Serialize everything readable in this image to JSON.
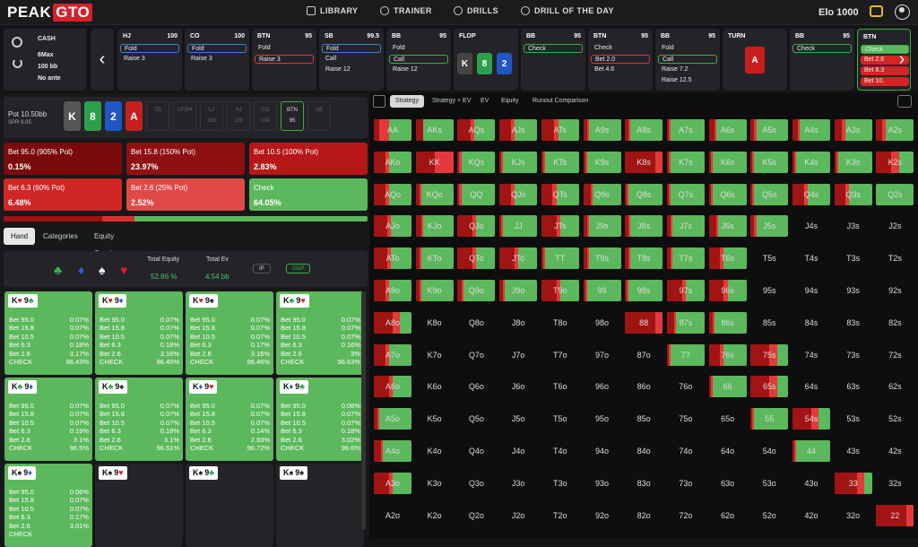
{
  "header": {
    "logo_a": "PEAK",
    "logo_b": "GTO",
    "nav": [
      "LIBRARY",
      "TRAINER",
      "DRILLS",
      "DRILL OF THE DAY"
    ],
    "elo": "Elo 1000"
  },
  "info": {
    "game": "CASH",
    "players": "6Max",
    "stack": "100 bb",
    "ante": "No ante"
  },
  "actions": [
    {
      "pos": "HJ",
      "stack": "100",
      "opts": [
        {
          "t": "Fold",
          "s": "blue"
        },
        {
          "t": "Raise 3",
          "s": ""
        }
      ]
    },
    {
      "pos": "CO",
      "stack": "100",
      "opts": [
        {
          "t": "Fold",
          "s": "blue"
        },
        {
          "t": "Raise 3",
          "s": ""
        }
      ]
    },
    {
      "pos": "BTN",
      "stack": "95",
      "opts": [
        {
          "t": "Fold",
          "s": ""
        },
        {
          "t": "Raise 3",
          "s": "red"
        }
      ]
    },
    {
      "pos": "SB",
      "stack": "99.5",
      "opts": [
        {
          "t": "Fold",
          "s": "blue"
        },
        {
          "t": "Call",
          "s": ""
        },
        {
          "t": "Raise 12",
          "s": ""
        }
      ]
    },
    {
      "pos": "BB",
      "stack": "95",
      "opts": [
        {
          "t": "Fold",
          "s": ""
        },
        {
          "t": "Call",
          "s": "green"
        },
        {
          "t": "Raise 12",
          "s": ""
        }
      ]
    },
    {
      "pos": "FLOP",
      "stack": "",
      "opts": []
    },
    {
      "pos": "BB",
      "stack": "95",
      "opts": [
        {
          "t": "Check",
          "s": "green"
        }
      ]
    },
    {
      "pos": "BTN",
      "stack": "95",
      "opts": [
        {
          "t": "Check",
          "s": ""
        },
        {
          "t": "Bet 2.0",
          "s": "red"
        },
        {
          "t": "Bet 4.6",
          "s": ""
        }
      ]
    },
    {
      "pos": "BB",
      "stack": "95",
      "opts": [
        {
          "t": "Fold",
          "s": ""
        },
        {
          "t": "Call",
          "s": "green"
        },
        {
          "t": "Raise 7.2",
          "s": ""
        },
        {
          "t": "Raise 12.5",
          "s": ""
        }
      ]
    },
    {
      "pos": "TURN",
      "stack": "",
      "opts": []
    },
    {
      "pos": "BB",
      "stack": "95",
      "opts": [
        {
          "t": "Check",
          "s": "green"
        }
      ]
    },
    {
      "pos": "BTN",
      "stack": "",
      "opts": [
        {
          "t": "Check",
          "s": "green"
        },
        {
          "t": "Bet 2.6",
          "s": ""
        },
        {
          "t": "Bet 6.3",
          "s": ""
        },
        {
          "t": "Bet 10.",
          "s": ""
        }
      ]
    }
  ],
  "flop_cards": [
    {
      "r": "K",
      "c": "#444"
    },
    {
      "r": "8",
      "c": "#2aa04a"
    },
    {
      "r": "2",
      "c": "#1f56c4"
    }
  ],
  "turn_card": {
    "r": "A",
    "c": "#c81e1e"
  },
  "pot": {
    "pot": "Pot  10.50bb",
    "spr": "SPR 9.05"
  },
  "board": [
    {
      "r": "K",
      "c": "#555"
    },
    {
      "r": "8",
      "c": "#2aa04a"
    },
    {
      "r": "2",
      "c": "#1f56c4"
    },
    {
      "r": "A",
      "c": "#c81e1e"
    }
  ],
  "seats": [
    {
      "n": "TB",
      "v": ""
    },
    {
      "n": "UTGH",
      "v": ""
    },
    {
      "n": "LJ",
      "v": "100"
    },
    {
      "n": "HJ",
      "v": "100"
    },
    {
      "n": "CO",
      "v": "100"
    },
    {
      "n": "BTN",
      "v": "95"
    },
    {
      "n": "SB",
      "v": ""
    }
  ],
  "bets": [
    {
      "l": "Bet 95.0 (905% Pot)",
      "v": "0.15%",
      "c": "#7a0a0a"
    },
    {
      "l": "Bet 15.8 (150% Pot)",
      "v": "23.97%",
      "c": "#8f1010"
    },
    {
      "l": "Bet 10.5 (100% Pot)",
      "v": "2.83%",
      "c": "#b71717"
    },
    {
      "l": "Bet 6.3 (60% Pot)",
      "v": "6.48%",
      "c": "#cf2626"
    },
    {
      "l": "Bet 2.6 (25% Pot)",
      "v": "2.52%",
      "c": "#e14848"
    },
    {
      "l": "Check",
      "v": "64.05%",
      "c": "#5cb85c"
    }
  ],
  "subtabs": [
    "Hand",
    "Categories",
    "Equity Graph"
  ],
  "equity": {
    "te_label": "Total Equity",
    "te": "52.86 %",
    "ev_label": "Total Ev",
    "ev": "4.54 bb",
    "ip": "IP",
    "oop": "OOP"
  },
  "suits": [
    {
      "s": "♣",
      "c": "#3bb54a"
    },
    {
      "s": "♦",
      "c": "#2b5fd8"
    },
    {
      "s": "♠",
      "c": "#ffffff"
    },
    {
      "s": "♥",
      "c": "#d8202a"
    }
  ],
  "combos": [
    {
      "a": "K",
      "as": "♥",
      "asc": "#d8202a",
      "b": "9",
      "bs": "♣",
      "bsc": "#2aa04a",
      "v": [
        "0.07%",
        "0.07%",
        "0.07%",
        "0.18%",
        "3.17%",
        "96.43%"
      ],
      "dark": false
    },
    {
      "a": "K",
      "as": "♥",
      "asc": "#d8202a",
      "b": "9",
      "bs": "♦",
      "bsc": "#1f56c4",
      "v": [
        "0.07%",
        "0.07%",
        "0.07%",
        "0.18%",
        "3.16%",
        "96.45%"
      ],
      "dark": false
    },
    {
      "a": "K",
      "as": "♥",
      "asc": "#d8202a",
      "b": "9",
      "bs": "♠",
      "bsc": "#111",
      "v": [
        "0.07%",
        "0.07%",
        "0.07%",
        "0.17%",
        "3.16%",
        "96.46%"
      ],
      "dark": false
    },
    {
      "a": "K",
      "as": "♣",
      "asc": "#2aa04a",
      "b": "9",
      "bs": "♥",
      "bsc": "#d8202a",
      "v": [
        "0.07%",
        "0.07%",
        "0.07%",
        "0.16%",
        "3%",
        "96.63%"
      ],
      "dark": false
    },
    {
      "a": "K",
      "as": "♣",
      "asc": "#2aa04a",
      "b": "9",
      "bs": "♦",
      "bsc": "#1f56c4",
      "v": [
        "0.07%",
        "0.07%",
        "0.07%",
        "0.19%",
        "3.1%",
        "96.5%"
      ],
      "dark": false
    },
    {
      "a": "K",
      "as": "♣",
      "asc": "#2aa04a",
      "b": "9",
      "bs": "♠",
      "bsc": "#111",
      "v": [
        "0.07%",
        "0.07%",
        "0.07%",
        "0.18%",
        "3.1%",
        "96.51%"
      ],
      "dark": false
    },
    {
      "a": "K",
      "as": "♦",
      "asc": "#1f56c4",
      "b": "9",
      "bs": "♥",
      "bsc": "#d8202a",
      "v": [
        "0.07%",
        "0.07%",
        "0.07%",
        "0.14%",
        "2.93%",
        "96.72%"
      ],
      "dark": false
    },
    {
      "a": "K",
      "as": "♦",
      "asc": "#1f56c4",
      "b": "9",
      "bs": "♣",
      "bsc": "#2aa04a",
      "v": [
        "0.06%",
        "0.07%",
        "0.07%",
        "0.18%",
        "3.02%",
        "96.6%"
      ],
      "dark": false
    },
    {
      "a": "K",
      "as": "♠",
      "asc": "#111",
      "b": "9",
      "bs": "♦",
      "bsc": "#1f56c4",
      "v": [
        "0.06%",
        "0.07%",
        "0.07%",
        "0.17%",
        "3.01%",
        ""
      ],
      "dark": false
    },
    {
      "a": "K",
      "as": "♠",
      "asc": "#111",
      "b": "9",
      "bs": "♥",
      "bsc": "#d8202a",
      "v": [],
      "dark": true
    },
    {
      "a": "K",
      "as": "♠",
      "asc": "#111",
      "b": "9",
      "bs": "♣",
      "bsc": "#2aa04a",
      "v": [],
      "dark": true
    },
    {
      "a": "K",
      "as": "♠",
      "asc": "#111",
      "b": "9",
      "bs": "♠",
      "bsc": "#111",
      "v": [],
      "dark": true
    }
  ],
  "combo_row_labels": [
    "Bet 95.0",
    "Bet 15.8",
    "Bet 10.5",
    "Bet 6.3",
    "Bet 2.6",
    "CHECK"
  ],
  "right_tabs": [
    "Strategy",
    "Strategy + EV",
    "EV",
    "Equity",
    "Runout Comparison"
  ],
  "matrix_ranks": [
    "A",
    "K",
    "Q",
    "J",
    "T",
    "9",
    "8",
    "7",
    "6",
    "5",
    "4",
    "3",
    "2"
  ],
  "matrix": {
    "AA": [
      0.15,
      0.25
    ],
    "AKs": [
      0.2,
      0
    ],
    "AQs": [
      0.35,
      0.1
    ],
    "AJs": [
      0.3,
      0.1
    ],
    "ATs": [
      0.35,
      0.1
    ],
    "A9s": [
      0.1,
      0.05
    ],
    "A8s": [
      0.1,
      0.05
    ],
    "A7s": [
      0.05,
      0.05
    ],
    "A6s": [
      0.15,
      0.05
    ],
    "A5s": [
      0.1,
      0.05
    ],
    "A4s": [
      0.15,
      0.05
    ],
    "A3s": [
      0.2,
      0.1
    ],
    "A2s": [
      0.15,
      0.1
    ],
    "AKo": [
      0.3,
      0.1
    ],
    "KK": [
      0.5,
      0.5
    ],
    "KQs": [
      0.05,
      0.05
    ],
    "KJs": [
      0.05,
      0.05
    ],
    "KTs": [
      0.05,
      0.05
    ],
    "K9s": [
      0.05,
      0.05
    ],
    "K8s": [
      0.8,
      0.2
    ],
    "K7s": [
      0.05,
      0.05
    ],
    "K6s": [
      0.05,
      0.05
    ],
    "K5s": [
      0.05,
      0.05
    ],
    "K4s": [
      0.05,
      0.05
    ],
    "K3s": [
      0.05,
      0.05
    ],
    "K2s": [
      0.4,
      0.2
    ],
    "AQo": [
      0.3,
      0.1
    ],
    "KQo": [
      0.1,
      0.05
    ],
    "QQ": [
      0.05,
      0.05
    ],
    "QJs": [
      0.3,
      0.1
    ],
    "QTs": [
      0.3,
      0.1
    ],
    "Q9s": [
      0.2,
      0.05
    ],
    "Q8s": [
      0.05,
      0.05
    ],
    "Q7s": [
      0.05,
      0.05
    ],
    "Q6s": [
      0.05,
      0.05
    ],
    "Q5s": [
      0.05,
      0.05
    ],
    "Q4s": [
      0.3,
      0.1
    ],
    "Q3s": [
      0.3,
      0.1
    ],
    "Q2s": [
      0,
      0
    ],
    "AJo": [
      0.35,
      0.1
    ],
    "KJo": [
      0.15,
      0.05
    ],
    "QJo": [
      0.4,
      0.1
    ],
    "JJ": [
      0.05,
      0.05
    ],
    "JTs": [
      0.4,
      0.1
    ],
    "J9s": [
      0.1,
      0.05
    ],
    "J8s": [
      0.1,
      0.05
    ],
    "J7s": [
      0.1,
      0.05
    ],
    "J6s": [
      0.2,
      0.05
    ],
    "J5s": [
      0.1,
      0.05
    ],
    "J4s": [
      0,
      0
    ],
    "J3s": [
      0,
      0
    ],
    "J2s": [
      0,
      0
    ],
    "ATo": [
      0.35,
      0.1
    ],
    "KTo": [
      0.1,
      0.05
    ],
    "QTo": [
      0.4,
      0.1
    ],
    "JTo": [
      0.4,
      0.1
    ],
    "TT": [
      0.05,
      0.05
    ],
    "T9s": [
      0.1,
      0.05
    ],
    "T8s": [
      0.1,
      0.05
    ],
    "T7s": [
      0.1,
      0.05
    ],
    "T6s": [
      0.3,
      0.1
    ],
    "T5s": [
      0,
      0
    ],
    "T4s": [
      0,
      0
    ],
    "T3s": [
      0,
      0
    ],
    "T2s": [
      0,
      0
    ],
    "A9o": [
      0.3,
      0.1
    ],
    "K9o": [
      0.1,
      0.05
    ],
    "Q9o": [
      0.1,
      0.05
    ],
    "J9o": [
      0.1,
      0.05
    ],
    "T9o": [
      0.4,
      0.1
    ],
    "99": [
      0.05,
      0.05
    ],
    "98s": [
      0.05,
      0.05
    ],
    "97s": [
      0.4,
      0.1
    ],
    "96s": [
      0.4,
      0.1
    ],
    "95s": [
      0,
      0
    ],
    "94s": [
      0,
      0
    ],
    "93s": [
      0,
      0
    ],
    "92s": [
      0,
      0
    ],
    "A8o": [
      0.5,
      0.2
    ],
    "K8o": [
      0,
      0
    ],
    "Q8o": [
      0,
      0
    ],
    "J8o": [
      0,
      0
    ],
    "T8o": [
      0,
      0
    ],
    "98o": [
      0,
      0
    ],
    "88": [
      0.8,
      0.2
    ],
    "87s": [
      0.2,
      0.05
    ],
    "86s": [
      0.1,
      0.05
    ],
    "85s": [
      0,
      0
    ],
    "84s": [
      0,
      0
    ],
    "83s": [
      0,
      0
    ],
    "82s": [
      0,
      0
    ],
    "A7o": [
      0.3,
      0.1
    ],
    "K7o": [
      0,
      0
    ],
    "Q7o": [
      0,
      0
    ],
    "J7o": [
      0,
      0
    ],
    "T7o": [
      0,
      0
    ],
    "97o": [
      0,
      0
    ],
    "87o": [
      0,
      0
    ],
    "77": [
      0.05,
      0.05
    ],
    "76s": [
      0.3,
      0.1
    ],
    "75s": [
      0.5,
      0.2
    ],
    "74s": [
      0,
      0
    ],
    "73s": [
      0,
      0
    ],
    "72s": [
      0,
      0
    ],
    "A6o": [
      0.4,
      0.1
    ],
    "K6o": [
      0,
      0
    ],
    "Q6o": [
      0,
      0
    ],
    "J6o": [
      0,
      0
    ],
    "T6o": [
      0,
      0
    ],
    "96o": [
      0,
      0
    ],
    "86o": [
      0,
      0
    ],
    "76o": [
      0,
      0
    ],
    "66": [
      0.05,
      0.05
    ],
    "65s": [
      0.5,
      0.2
    ],
    "64s": [
      0,
      0
    ],
    "63s": [
      0,
      0
    ],
    "62s": [
      0,
      0
    ],
    "A5o": [
      0.1,
      0.05
    ],
    "K5o": [
      0,
      0
    ],
    "Q5o": [
      0,
      0
    ],
    "J5o": [
      0,
      0
    ],
    "T5o": [
      0,
      0
    ],
    "95o": [
      0,
      0
    ],
    "85o": [
      0,
      0
    ],
    "75o": [
      0,
      0
    ],
    "65o": [
      0,
      0
    ],
    "55": [
      0.05,
      0.05
    ],
    "54s": [
      0.5,
      0.2
    ],
    "53s": [
      0,
      0
    ],
    "52s": [
      0,
      0
    ],
    "A4o": [
      0.2,
      0.05
    ],
    "K4o": [
      0,
      0
    ],
    "Q4o": [
      0,
      0
    ],
    "J4o": [
      0,
      0
    ],
    "T4o": [
      0,
      0
    ],
    "94o": [
      0,
      0
    ],
    "84o": [
      0,
      0
    ],
    "74o": [
      0,
      0
    ],
    "64o": [
      0,
      0
    ],
    "54o": [
      0,
      0
    ],
    "44": [
      0.05,
      0.05
    ],
    "43s": [
      0,
      0
    ],
    "42s": [
      0,
      0
    ],
    "A3o": [
      0.4,
      0.1
    ],
    "K3o": [
      0,
      0
    ],
    "Q3o": [
      0,
      0
    ],
    "J3o": [
      0,
      0
    ],
    "T3o": [
      0,
      0
    ],
    "93o": [
      0,
      0
    ],
    "83o": [
      0,
      0
    ],
    "73o": [
      0,
      0
    ],
    "63o": [
      0,
      0
    ],
    "53o": [
      0,
      0
    ],
    "43o": [
      0,
      0
    ],
    "33": [
      0.6,
      0.2
    ],
    "32s": [
      0,
      0
    ],
    "A2o": [
      0,
      0
    ],
    "K2o": [
      0,
      0
    ],
    "Q2o": [
      0,
      0
    ],
    "J2o": [
      0,
      0
    ],
    "T2o": [
      0,
      0
    ],
    "92o": [
      0,
      0
    ],
    "82o": [
      0,
      0
    ],
    "72o": [
      0,
      0
    ],
    "62o": [
      0,
      0
    ],
    "52o": [
      0,
      0
    ],
    "42o": [
      0,
      0
    ],
    "32o": [
      0,
      0
    ],
    "22": [
      0.8,
      0.2
    ]
  }
}
